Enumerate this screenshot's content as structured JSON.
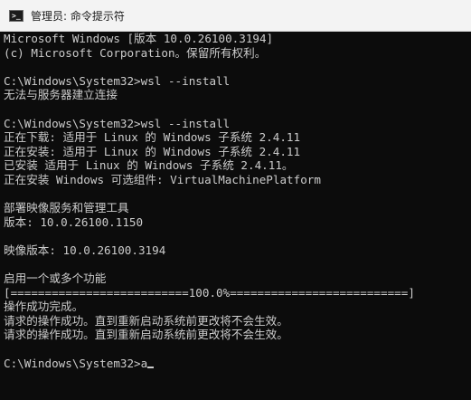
{
  "window": {
    "title": "管理员: 命令提示符",
    "icon": "cmd-icon"
  },
  "terminal": {
    "lines": [
      "Microsoft Windows [版本 10.0.26100.3194]",
      "(c) Microsoft Corporation。保留所有权利。",
      "",
      "C:\\Windows\\System32>wsl --install",
      "无法与服务器建立连接",
      "",
      "C:\\Windows\\System32>wsl --install",
      "正在下载: 适用于 Linux 的 Windows 子系统 2.4.11",
      "正在安装: 适用于 Linux 的 Windows 子系统 2.4.11",
      "已安装 适用于 Linux 的 Windows 子系统 2.4.11。",
      "正在安装 Windows 可选组件: VirtualMachinePlatform",
      "",
      "部署映像服务和管理工具",
      "版本: 10.0.26100.1150",
      "",
      "映像版本: 10.0.26100.3194",
      "",
      "启用一个或多个功能",
      "[==========================100.0%==========================]",
      "操作成功完成。",
      "请求的操作成功。直到重新启动系统前更改将不会生效。",
      "请求的操作成功。直到重新启动系统前更改将不会生效。",
      "",
      "C:\\Windows\\System32>a"
    ]
  }
}
